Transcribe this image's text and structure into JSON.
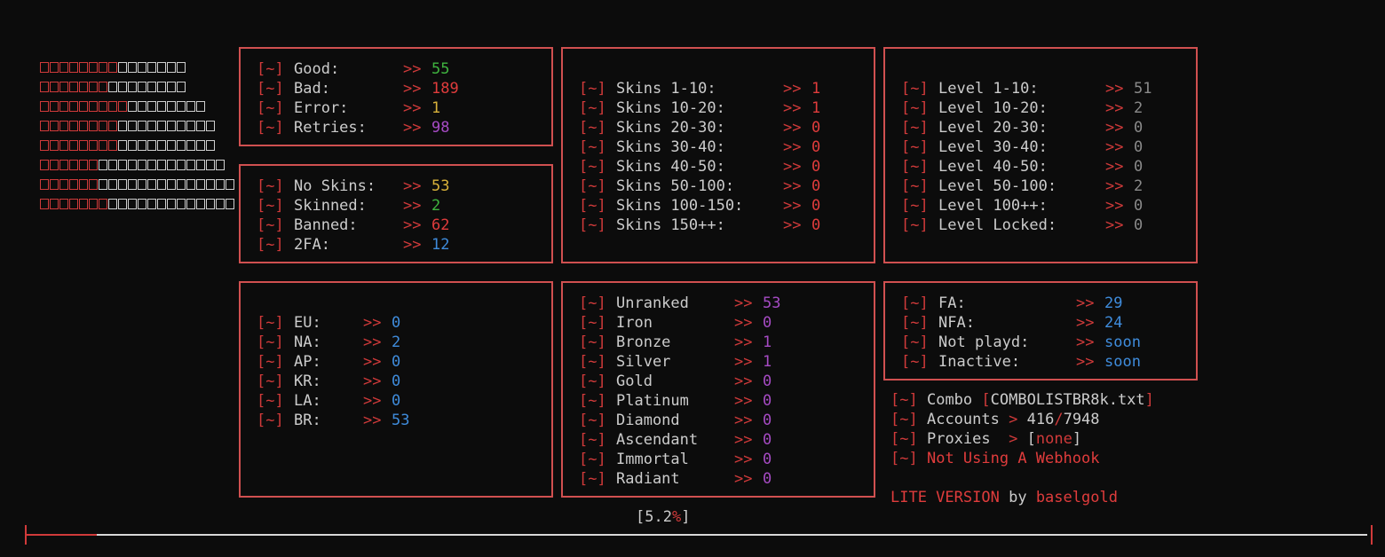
{
  "stats": [
    {
      "label": "Good:",
      "value": "55",
      "color": "green"
    },
    {
      "label": "Bad:",
      "value": "189",
      "color": "red"
    },
    {
      "label": "Error:",
      "value": "1",
      "color": "yellow"
    },
    {
      "label": "Retries:",
      "value": "98",
      "color": "purple"
    }
  ],
  "skin_stats": [
    {
      "label": "No Skins:",
      "value": "53",
      "color": "yellow"
    },
    {
      "label": "Skinned:",
      "value": "2",
      "color": "green"
    },
    {
      "label": "Banned:",
      "value": "62",
      "color": "red"
    },
    {
      "label": "2FA:",
      "value": "12",
      "color": "blue"
    }
  ],
  "skins": [
    {
      "label": "Skins 1-10:",
      "value": "1"
    },
    {
      "label": "Skins 10-20:",
      "value": "1"
    },
    {
      "label": "Skins 20-30:",
      "value": "0"
    },
    {
      "label": "Skins 30-40:",
      "value": "0"
    },
    {
      "label": "Skins 40-50:",
      "value": "0"
    },
    {
      "label": "Skins 50-100:",
      "value": "0"
    },
    {
      "label": "Skins 100-150:",
      "value": "0"
    },
    {
      "label": "Skins 150++:",
      "value": "0"
    }
  ],
  "levels": [
    {
      "label": "Level 1-10:",
      "value": "51"
    },
    {
      "label": "Level 10-20:",
      "value": "2"
    },
    {
      "label": "Level 20-30:",
      "value": "0"
    },
    {
      "label": "Level 30-40:",
      "value": "0"
    },
    {
      "label": "Level 40-50:",
      "value": "0"
    },
    {
      "label": "Level 50-100:",
      "value": "2"
    },
    {
      "label": "Level 100++:",
      "value": "0"
    },
    {
      "label": "Level Locked:",
      "value": "0"
    }
  ],
  "regions": [
    {
      "label": "EU:",
      "value": "0"
    },
    {
      "label": "NA:",
      "value": "2"
    },
    {
      "label": "AP:",
      "value": "0"
    },
    {
      "label": "KR:",
      "value": "0"
    },
    {
      "label": "LA:",
      "value": "0"
    },
    {
      "label": "BR:",
      "value": "53"
    }
  ],
  "ranks": [
    {
      "label": "Unranked",
      "value": "53"
    },
    {
      "label": "Iron",
      "value": "0"
    },
    {
      "label": "Bronze",
      "value": "1"
    },
    {
      "label": "Silver",
      "value": "1"
    },
    {
      "label": "Gold",
      "value": "0"
    },
    {
      "label": "Platinum",
      "value": "0"
    },
    {
      "label": "Diamond",
      "value": "0"
    },
    {
      "label": "Ascendant",
      "value": "0"
    },
    {
      "label": "Immortal",
      "value": "0"
    },
    {
      "label": "Radiant",
      "value": "0"
    }
  ],
  "access": [
    {
      "label": "FA:",
      "value": "29"
    },
    {
      "label": "NFA:",
      "value": "24"
    },
    {
      "label": "Not playd:",
      "value": "soon"
    },
    {
      "label": "Inactive:",
      "value": "soon"
    }
  ],
  "prefix": "[~]",
  "arrow_long": ">>",
  "arrow_short": ">",
  "info": {
    "combo_label": "Combo",
    "combo_file": "COMBOLISTBR8k.txt",
    "accounts_label": "Accounts",
    "accounts_done": "416",
    "accounts_sep": "/",
    "accounts_total": "7948",
    "proxies_label": "Proxies",
    "proxies_value": "none",
    "webhook_status": "Not Using A Webhook",
    "version": "LITE VERSION",
    "by": "by",
    "author": "baselgold"
  },
  "progress": {
    "percent_text": "5.2",
    "percent_sign": "%",
    "fraction": 0.052
  },
  "colors": {
    "accent": "#d03a3a",
    "border": "#d05050",
    "green": "#3fb33f",
    "red": "#e03c3c",
    "yellow": "#d8b13a",
    "purple": "#a64bc4",
    "blue": "#3f8cdc",
    "gray": "#8a8a8a"
  }
}
